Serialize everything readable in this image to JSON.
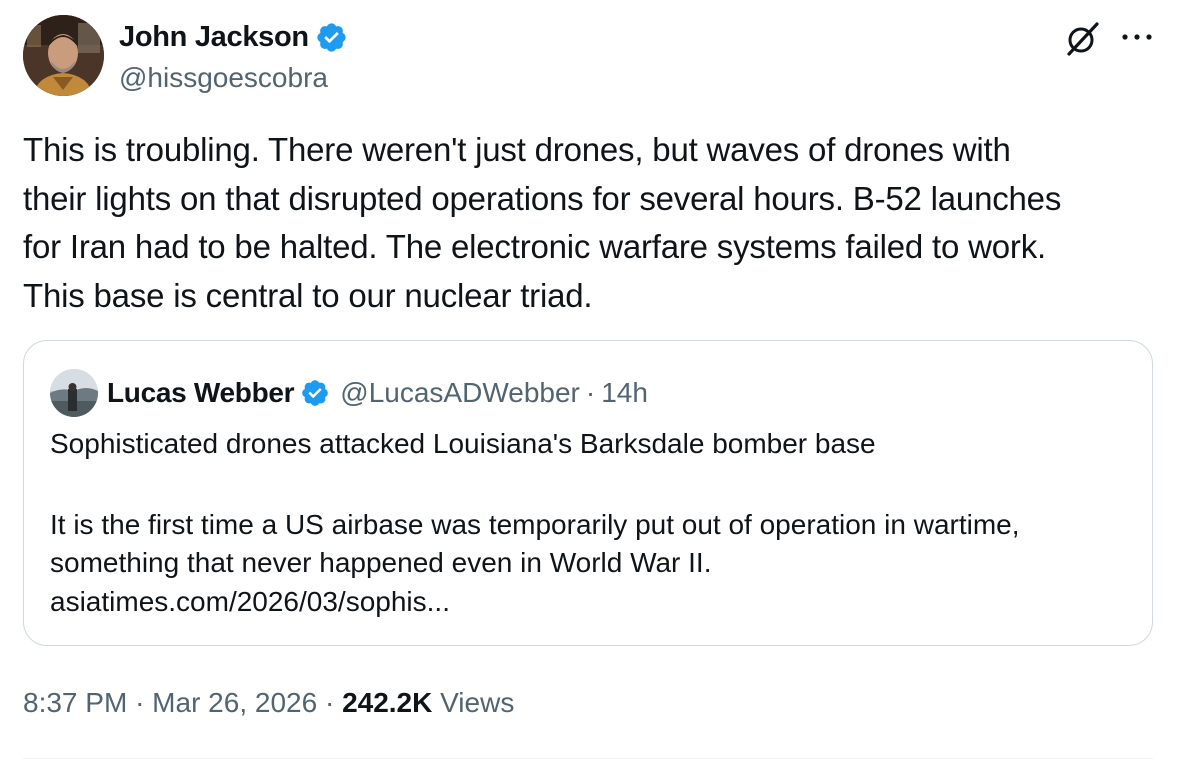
{
  "author": {
    "display_name": "John Jackson",
    "handle": "@hissgoescobra",
    "verified": true
  },
  "tweet": {
    "text_lines": [
      "This is troubling. There weren't just drones, but waves of drones with",
      "their lights on that disrupted operations for several hours. B-52 launches",
      "for Iran had to be halted. The electronic warfare systems failed to work.",
      "This base is central to our nuclear triad."
    ]
  },
  "quote": {
    "display_name": "Lucas Webber",
    "handle": "@LucasADWebber",
    "separator": "·",
    "time": "14h",
    "verified": true,
    "lines": [
      "Sophisticated drones attacked Louisiana's Barksdale bomber base",
      "It is the first time a US airbase was temporarily put out of operation in wartime,",
      "something that never happened even in World War II.",
      "asiatimes.com/2026/03/sophis..."
    ]
  },
  "meta": {
    "time": "8:37 PM",
    "sep1": "·",
    "date": "Mar 26, 2026",
    "sep2": "·",
    "views_count": "242.2K",
    "views_label": "Views"
  },
  "icons": {
    "verified": "verified-badge-icon",
    "grok": "grok-icon",
    "more": "more-icon"
  },
  "colors": {
    "verified_blue": "#1d9bf0",
    "secondary_text": "#536471",
    "primary_text": "#0f1419",
    "border": "#cfd9de"
  }
}
